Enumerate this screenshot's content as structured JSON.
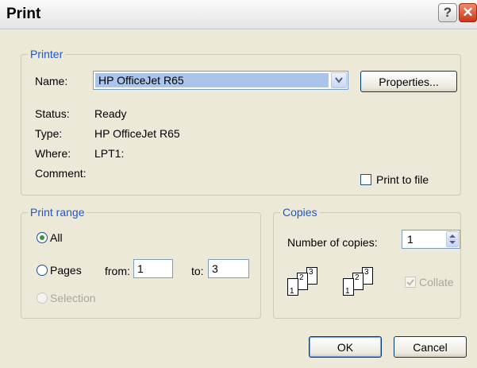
{
  "window": {
    "title": "Print",
    "help_glyph": "?",
    "close_glyph": "✕"
  },
  "printer": {
    "legend": "Printer",
    "name_label": "Name:",
    "name_value": "HP OfficeJet R65",
    "properties_label": "Properties...",
    "status_label": "Status:",
    "status_value": "Ready",
    "type_label": "Type:",
    "type_value": "HP OfficeJet R65",
    "where_label": "Where:",
    "where_value": "LPT1:",
    "comment_label": "Comment:",
    "print_to_file_label": "Print to file",
    "print_to_file_checked": false
  },
  "print_range": {
    "legend": "Print range",
    "all_label": "All",
    "all_selected": true,
    "pages_label": "Pages",
    "from_label": "from:",
    "from_value": "1",
    "to_label": "to:",
    "to_value": "3",
    "selection_label": "Selection"
  },
  "copies": {
    "legend": "Copies",
    "number_label": "Number of copies:",
    "number_value": "1",
    "collate_label": "Collate",
    "collate_checked": true,
    "page_digits": [
      "1",
      "2",
      "3"
    ]
  },
  "buttons": {
    "ok": "OK",
    "cancel": "Cancel"
  },
  "colors": {
    "legend_text": "#1f56c8",
    "dialog_bg": "#ece9d8",
    "selection_highlight": "#abc4ea",
    "close_button": "#c9371a",
    "radio_dot": "#2f9a2f"
  },
  "icons": {
    "help": "help-icon",
    "close": "close-icon",
    "dropdown": "chevron-down-icon",
    "spinner": "spinner-arrows-icon",
    "collate": "collate-pages-icon",
    "checkmark": "checkmark-icon"
  }
}
